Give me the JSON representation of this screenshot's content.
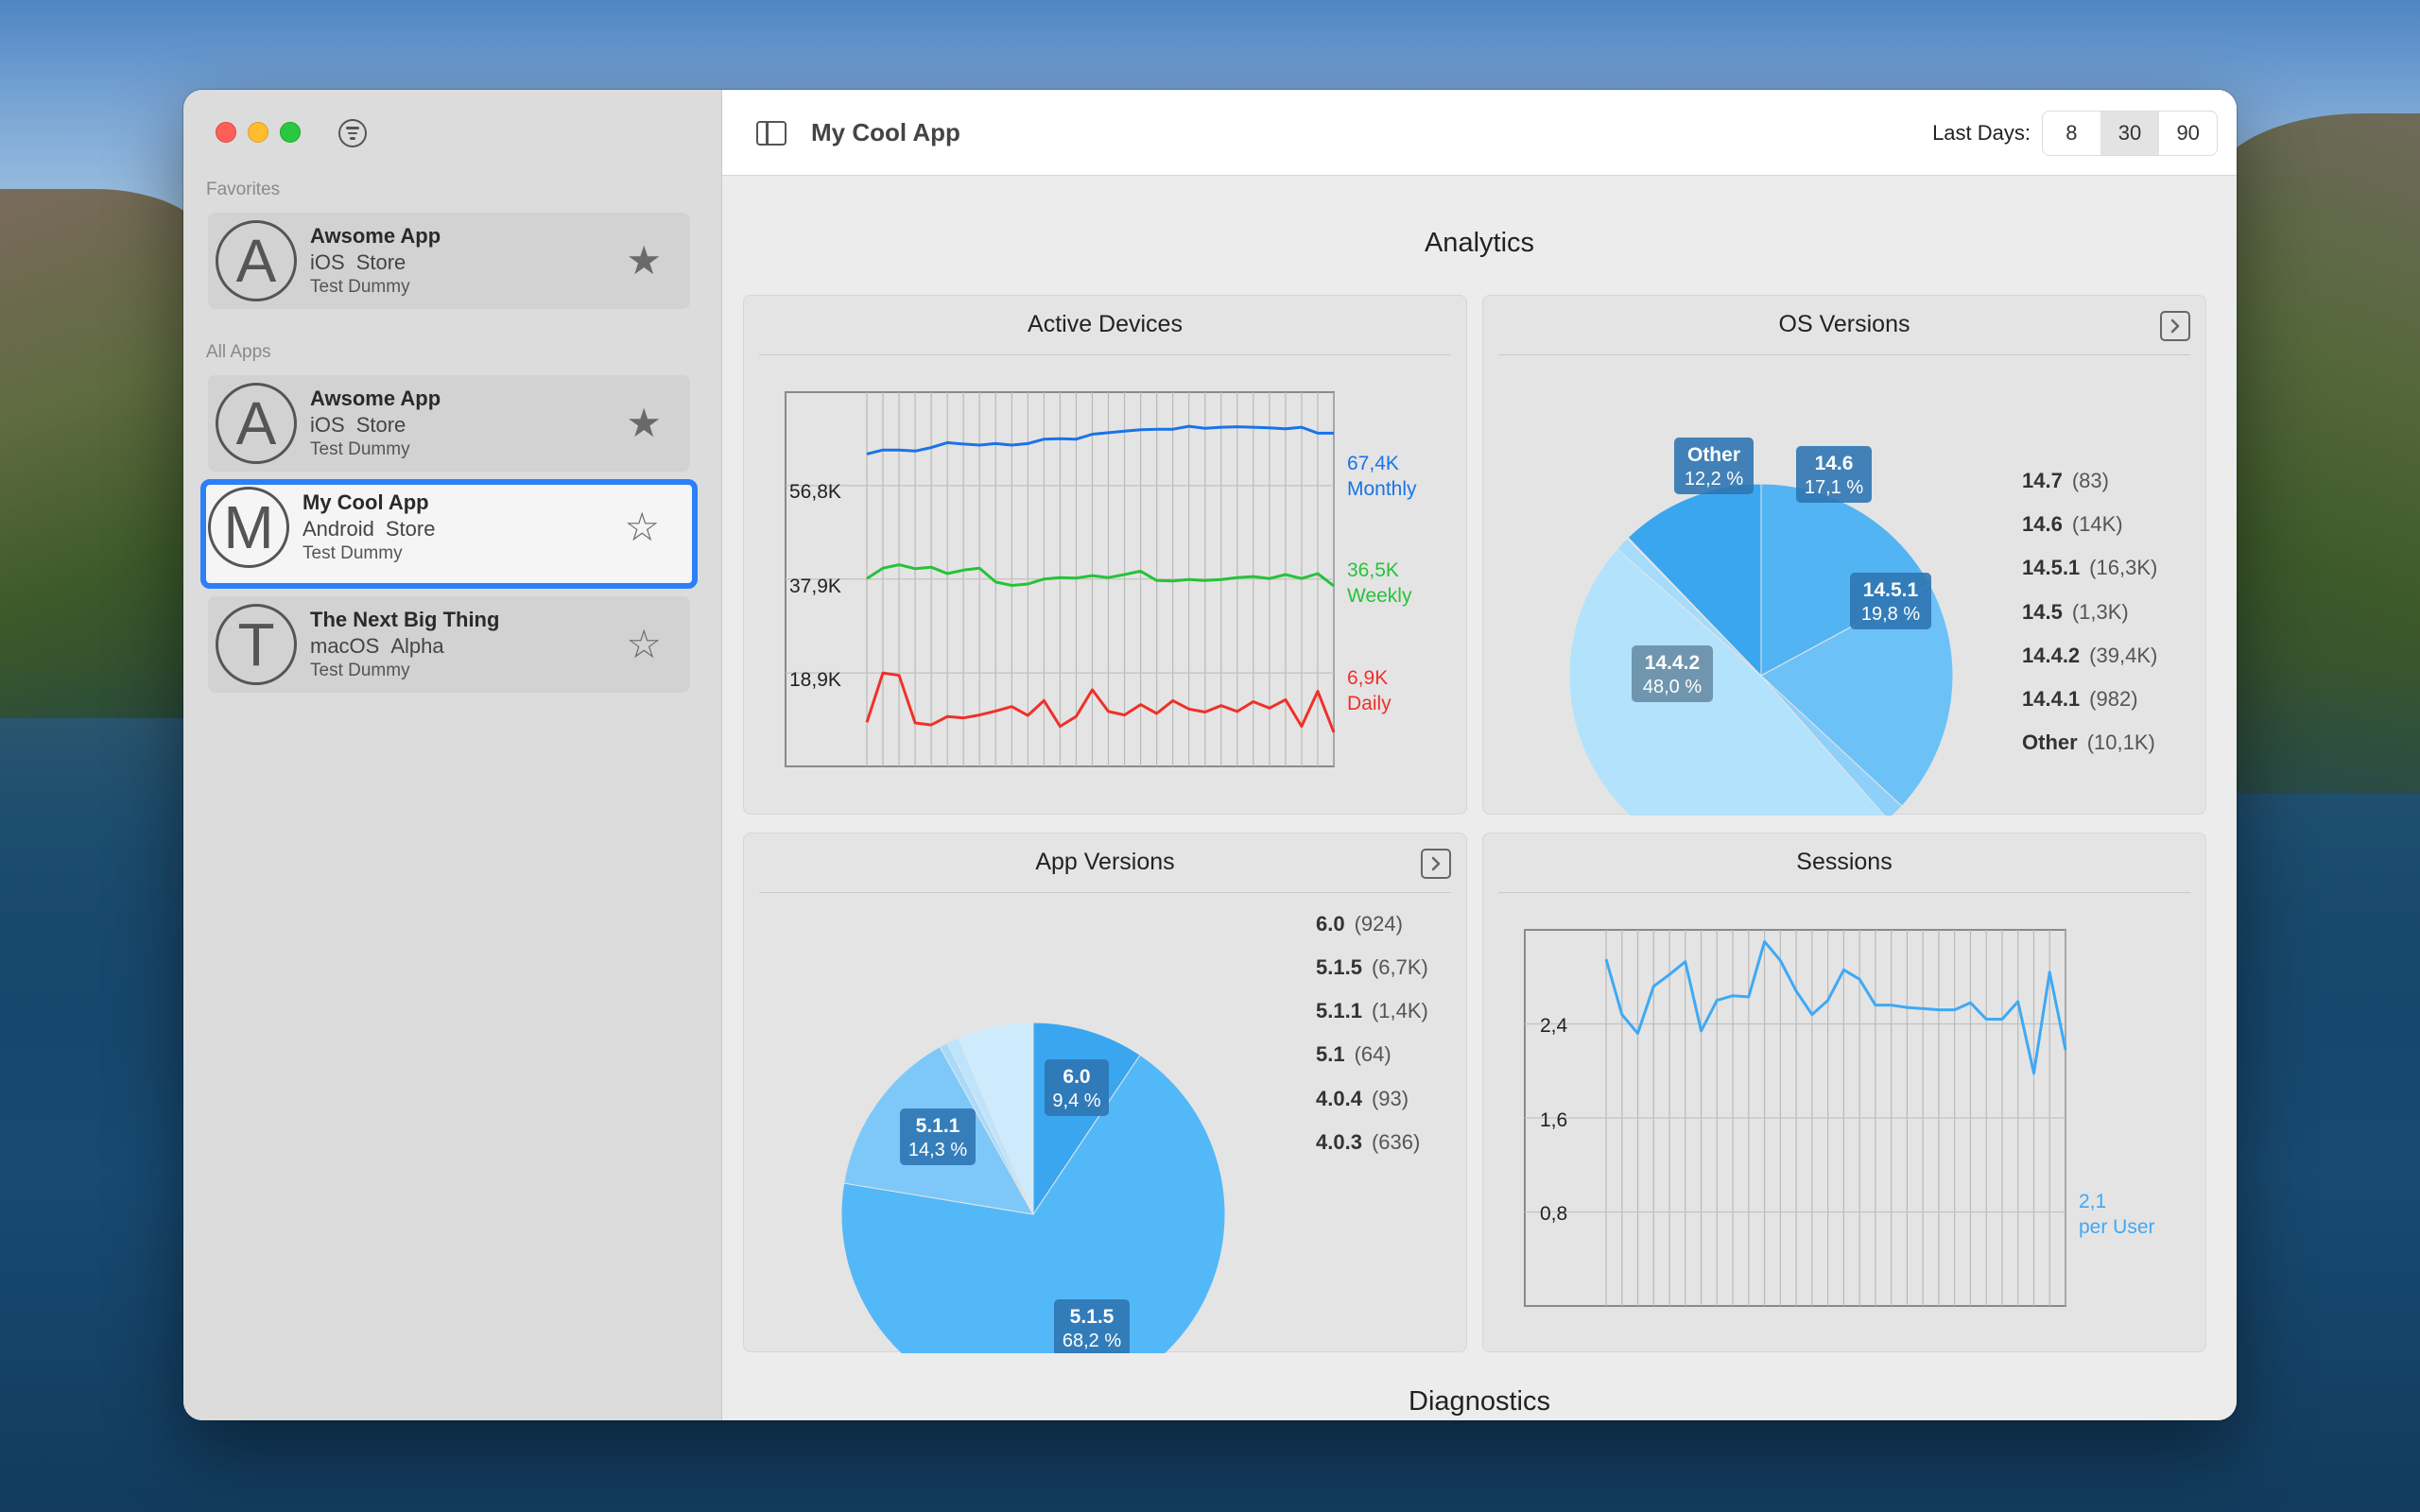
{
  "window": {
    "title": "My Cool App"
  },
  "toolbar": {
    "last_days_label": "Last Days:",
    "ranges": [
      "8",
      "30",
      "90"
    ],
    "selected_range": "30"
  },
  "sidebar": {
    "favorites_label": "Favorites",
    "all_apps_label": "All Apps",
    "favorites": [
      {
        "initial": "A",
        "name": "Awsome App",
        "platform": "iOS",
        "store": "Store",
        "owner": "Test Dummy",
        "starred": true
      }
    ],
    "apps": [
      {
        "initial": "A",
        "name": "Awsome App",
        "platform": "iOS",
        "store": "Store",
        "owner": "Test Dummy",
        "starred": true
      },
      {
        "initial": "M",
        "name": "My Cool App",
        "platform": "Android",
        "store": "Store",
        "owner": "Test Dummy",
        "starred": false,
        "selected": true
      },
      {
        "initial": "T",
        "name": "The Next Big Thing",
        "platform": "macOS",
        "store": "Alpha",
        "owner": "Test Dummy",
        "starred": false
      }
    ]
  },
  "main": {
    "title": "Analytics",
    "footer_title": "Diagnostics"
  },
  "colors": {
    "monthly": "#1a73e8",
    "weekly": "#27c23a",
    "daily": "#f0302a",
    "sessions": "#3fa9f5"
  },
  "panels": {
    "active_devices": {
      "title": "Active Devices",
      "y_ticks": [
        "56,8K",
        "37,9K",
        "18,9K"
      ],
      "series_labels": [
        {
          "value": "67,4K",
          "name": "Monthly"
        },
        {
          "value": "36,5K",
          "name": "Weekly"
        },
        {
          "value": "6,9K",
          "name": "Daily"
        }
      ]
    },
    "os_versions": {
      "title": "OS Versions",
      "legend": [
        {
          "name": "14.7",
          "count": "(83)"
        },
        {
          "name": "14.6",
          "count": "(14K)"
        },
        {
          "name": "14.5.1",
          "count": "(16,3K)"
        },
        {
          "name": "14.5",
          "count": "(1,3K)"
        },
        {
          "name": "14.4.2",
          "count": "(39,4K)"
        },
        {
          "name": "14.4.1",
          "count": "(982)"
        },
        {
          "name": "Other",
          "count": "(10,1K)"
        }
      ],
      "slice_labels": [
        {
          "name": "Other",
          "pct": "12,2 %"
        },
        {
          "name": "14.6",
          "pct": "17,1 %"
        },
        {
          "name": "14.5.1",
          "pct": "19,8 %"
        },
        {
          "name": "14.4.2",
          "pct": "48,0 %"
        }
      ]
    },
    "app_versions": {
      "title": "App Versions",
      "legend": [
        {
          "name": "6.0",
          "count": "(924)"
        },
        {
          "name": "5.1.5",
          "count": "(6,7K)"
        },
        {
          "name": "5.1.1",
          "count": "(1,4K)"
        },
        {
          "name": "5.1",
          "count": "(64)"
        },
        {
          "name": "4.0.4",
          "count": "(93)"
        },
        {
          "name": "4.0.3",
          "count": "(636)"
        }
      ],
      "slice_labels": [
        {
          "name": "6.0",
          "pct": "9,4 %"
        },
        {
          "name": "5.1.1",
          "pct": "14,3 %"
        },
        {
          "name": "5.1.5",
          "pct": "68,2 %"
        }
      ]
    },
    "sessions": {
      "title": "Sessions",
      "y_ticks": [
        "2,4",
        "1,6",
        "0,8"
      ],
      "value": "2,1",
      "unit": "per User"
    }
  },
  "chart_data": [
    {
      "type": "line",
      "title": "Active Devices",
      "x": [
        1,
        2,
        3,
        4,
        5,
        6,
        7,
        8,
        9,
        10,
        11,
        12,
        13,
        14,
        15,
        16,
        17,
        18,
        19,
        20,
        21,
        22,
        23,
        24,
        25,
        26,
        27,
        28,
        29,
        30
      ],
      "series": [
        {
          "name": "Monthly",
          "values": [
            63.2,
            64.0,
            64.0,
            63.8,
            64.5,
            65.5,
            65.2,
            65.0,
            65.3,
            65.0,
            65.3,
            66.2,
            66.3,
            66.2,
            67.2,
            67.5,
            67.8,
            68.1,
            68.2,
            68.2,
            68.8,
            68.4,
            68.6,
            68.7,
            68.6,
            68.5,
            68.3,
            68.6,
            67.4,
            67.4
          ]
        },
        {
          "name": "Weekly",
          "values": [
            38.0,
            40.1,
            40.8,
            40.0,
            40.3,
            39.0,
            39.7,
            40.1,
            37.3,
            36.6,
            36.9,
            37.9,
            38.2,
            38.1,
            38.6,
            38.2,
            38.8,
            39.5,
            37.6,
            37.5,
            37.8,
            37.6,
            37.8,
            38.2,
            38.4,
            38.0,
            38.8,
            38.0,
            39.0,
            36.5
          ]
        },
        {
          "name": "Daily",
          "values": [
            8.9,
            18.9,
            18.4,
            8.8,
            8.4,
            10.1,
            9.8,
            10.4,
            11.2,
            12.1,
            10.3,
            13.3,
            8.1,
            10.1,
            15.5,
            11.1,
            10.4,
            12.5,
            10.7,
            13.3,
            11.6,
            11.0,
            12.3,
            11.1,
            13.1,
            11.8,
            13.5,
            8.1,
            15.2,
            6.9
          ]
        }
      ],
      "ylim": [
        0,
        75.7
      ]
    },
    {
      "type": "pie",
      "title": "OS Versions",
      "categories": [
        "Other",
        "14.6",
        "14.5.1",
        "14.5",
        "14.4.2",
        "14.4.1",
        "14.7"
      ],
      "values": [
        12.2,
        17.1,
        19.8,
        1.6,
        48.0,
        1.2,
        0.1
      ]
    },
    {
      "type": "pie",
      "title": "App Versions",
      "categories": [
        "6.0",
        "5.1.5",
        "5.1.1",
        "5.1",
        "4.0.4",
        "4.0.3"
      ],
      "values": [
        9.4,
        68.2,
        14.3,
        0.7,
        1.0,
        6.4
      ]
    },
    {
      "type": "line",
      "title": "Sessions",
      "x": [
        1,
        2,
        3,
        4,
        5,
        6,
        7,
        8,
        9,
        10,
        11,
        12,
        13,
        14,
        15,
        16,
        17,
        18,
        19,
        20,
        21,
        22,
        23,
        24,
        25,
        26,
        27,
        28,
        29,
        30
      ],
      "series": [
        {
          "name": "per User",
          "values": [
            2.95,
            2.48,
            2.32,
            2.72,
            2.82,
            2.93,
            2.34,
            2.6,
            2.64,
            2.63,
            3.1,
            2.94,
            2.68,
            2.48,
            2.6,
            2.86,
            2.78,
            2.56,
            2.56,
            2.54,
            2.53,
            2.52,
            2.52,
            2.58,
            2.44,
            2.44,
            2.59,
            1.98,
            2.84,
            2.18
          ]
        }
      ],
      "ylim": [
        0,
        3.2
      ]
    }
  ]
}
